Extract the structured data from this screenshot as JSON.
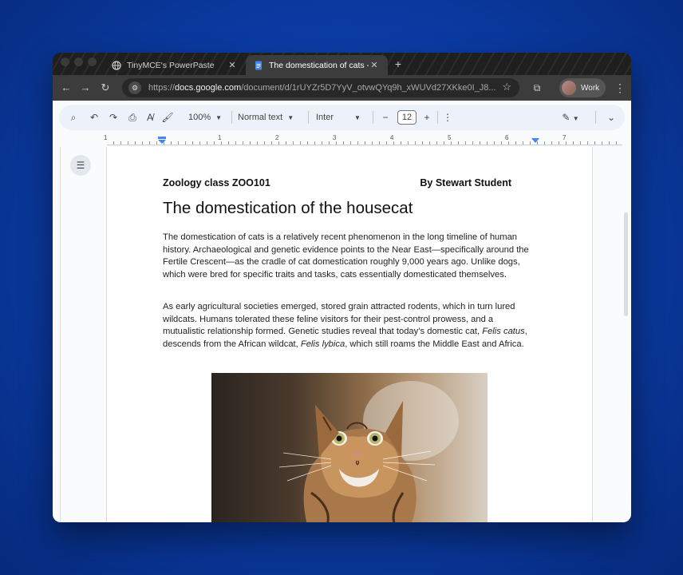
{
  "browser": {
    "tabs": [
      {
        "title": "TinyMCE's PowerPaste",
        "active": false,
        "icon": "globe-icon"
      },
      {
        "title": "The domestication of cats - G",
        "active": true,
        "icon": "docs-icon"
      }
    ],
    "new_tab": "+",
    "url_prefix": "https://",
    "url_host": "docs.google.com",
    "url_path": "/document/d/1rUYZr5D7YyV_otvwQYq9h_xWUVd27XKke0I_J8...",
    "profile_label": "Work"
  },
  "toolbar": {
    "zoom": "100%",
    "style": "Normal text",
    "font": "Inter",
    "font_size": "12",
    "minus": "−",
    "plus": "+"
  },
  "ruler": {
    "numbers": [
      "1",
      "1",
      "2",
      "3",
      "4",
      "5",
      "6",
      "7"
    ]
  },
  "document": {
    "header_left": "Zoology class ZOO101",
    "header_right": "By Stewart Student",
    "title": "The domestication of the housecat",
    "paragraph1": "The domestication of cats is a relatively recent phenomenon in the long timeline of human history. Archaeological and genetic evidence points to the Near East—specifically around the Fertile Crescent—as the cradle of cat domestication roughly 9,000 years ago. Unlike dogs, which were bred for specific traits and tasks, cats essentially domesticated themselves.",
    "paragraph2_a": "As early agricultural societies emerged, stored grain attracted rodents, which in turn lured wildcats. Humans tolerated these feline visitors for their pest-control prowess, and a mutualistic relationship formed. Genetic studies reveal that today’s domestic cat, ",
    "paragraph2_italic1": "Felis catus",
    "paragraph2_b": ", descends from the African wildcat, ",
    "paragraph2_italic2": "Felis lybica",
    "paragraph2_c": ", which still roams the Middle East and Africa."
  },
  "colors": {
    "background": "#0b3da8",
    "docs_blue": "#4285f4",
    "toolbar_bg": "#edf2fa"
  }
}
